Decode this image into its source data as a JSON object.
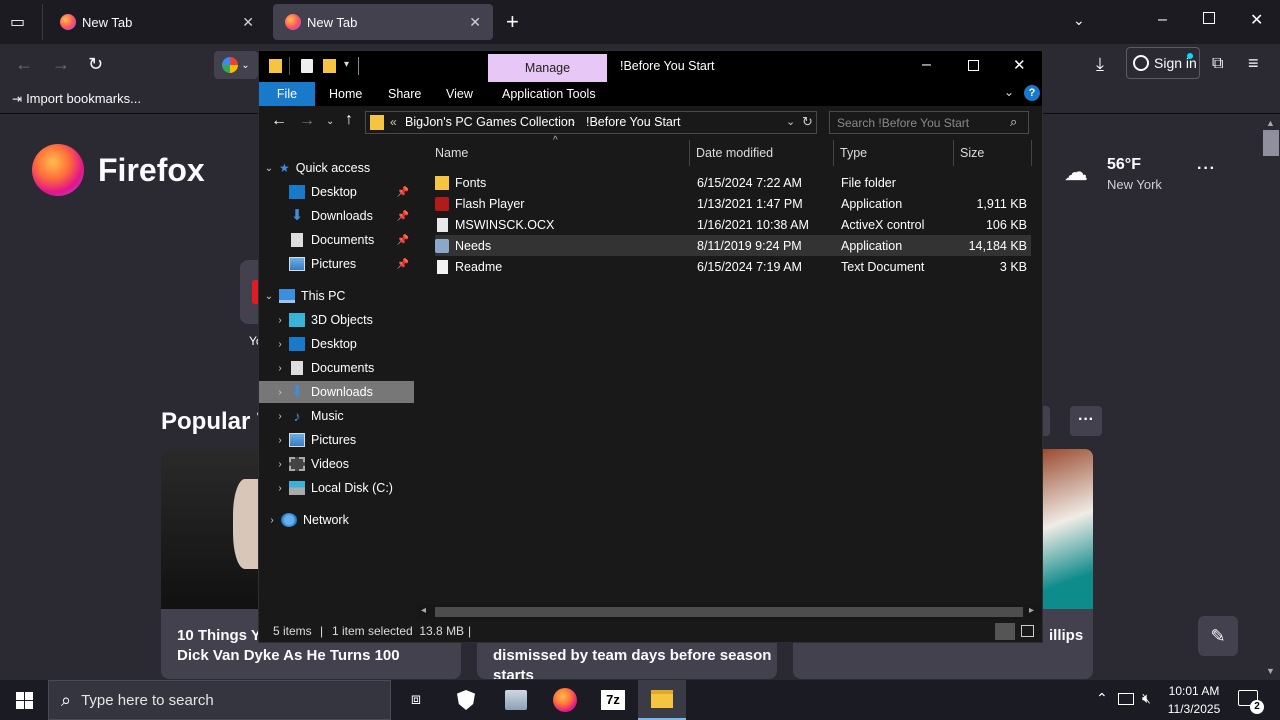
{
  "browser": {
    "tabs": [
      {
        "title": "New Tab",
        "active": false
      },
      {
        "title": "New Tab",
        "active": true
      }
    ],
    "bookmarks_bar": {
      "import_label": "Import bookmarks..."
    },
    "sign_in_label": "Sign in",
    "brand_name": "Firefox",
    "weather": {
      "temp": "56°F",
      "location": "New York"
    },
    "popular_heading": "Popular T",
    "shortcut_partial": "Yo",
    "stories": [
      {
        "title_line1": "10 Things Yo",
        "title_line2": "Dick Van Dyke As He Turns 100"
      },
      {
        "title_line1": "dismissed by team days before season",
        "title_line2": "starts"
      },
      {
        "title_partial": "illips"
      }
    ]
  },
  "explorer": {
    "ribbon_context_tab": "Manage",
    "window_title": "!Before You Start",
    "ribbon_tabs": [
      "File",
      "Home",
      "Share",
      "View",
      "Application Tools"
    ],
    "breadcrumb": {
      "prefix": "«",
      "parts": [
        "BigJon's PC Games Collection",
        "!Before You Start"
      ]
    },
    "search_placeholder": "Search !Before You Start",
    "columns": {
      "name": "Name",
      "date": "Date modified",
      "type": "Type",
      "size": "Size"
    },
    "files": [
      {
        "name": "Fonts",
        "date": "6/15/2024 7:22 AM",
        "type": "File folder",
        "size": "",
        "icon": "folder-icon",
        "selected": false
      },
      {
        "name": "Flash Player",
        "date": "1/13/2021 1:47 PM",
        "type": "Application",
        "size": "1,911 KB",
        "icon": "flash-icon",
        "selected": false
      },
      {
        "name": "MSWINSCK.OCX",
        "date": "1/16/2021 10:38 AM",
        "type": "ActiveX control",
        "size": "106 KB",
        "icon": "ocx-file-icon",
        "selected": false
      },
      {
        "name": "Needs",
        "date": "8/11/2019 9:24 PM",
        "type": "Application",
        "size": "14,184 KB",
        "icon": "app-icon",
        "selected": true
      },
      {
        "name": "Readme",
        "date": "6/15/2024 7:19 AM",
        "type": "Text Document",
        "size": "3 KB",
        "icon": "text-file-icon",
        "selected": false
      }
    ],
    "nav_tree": {
      "quick_access": {
        "label": "Quick access",
        "items": [
          {
            "label": "Desktop",
            "icon": "desktop-icon",
            "pinned": true
          },
          {
            "label": "Downloads",
            "icon": "downloads-icon",
            "pinned": true
          },
          {
            "label": "Documents",
            "icon": "documents-icon",
            "pinned": true
          },
          {
            "label": "Pictures",
            "icon": "pictures-icon",
            "pinned": true
          }
        ]
      },
      "this_pc": {
        "label": "This PC",
        "items": [
          {
            "label": "3D Objects",
            "icon": "3d-objects-icon"
          },
          {
            "label": "Desktop",
            "icon": "desktop-icon"
          },
          {
            "label": "Documents",
            "icon": "documents-icon"
          },
          {
            "label": "Downloads",
            "icon": "downloads-icon",
            "selected": true
          },
          {
            "label": "Music",
            "icon": "music-icon"
          },
          {
            "label": "Pictures",
            "icon": "pictures-icon"
          },
          {
            "label": "Videos",
            "icon": "videos-icon"
          },
          {
            "label": "Local Disk (C:)",
            "icon": "drive-icon"
          }
        ]
      },
      "network": {
        "label": "Network",
        "icon": "network-icon"
      }
    },
    "status": {
      "items": "5 items",
      "selection": "1 item selected  13.8 MB"
    }
  },
  "taskbar": {
    "search_placeholder": "Type here to search",
    "clock": {
      "time": "10:01 AM",
      "date": "11/3/2025"
    },
    "notification_count": "2"
  },
  "colors": {
    "ribbon_blue": "#1979ca",
    "manage_tab": "#e6c7f5",
    "selection": "#777777",
    "firefox_purple": "#9059ff"
  }
}
